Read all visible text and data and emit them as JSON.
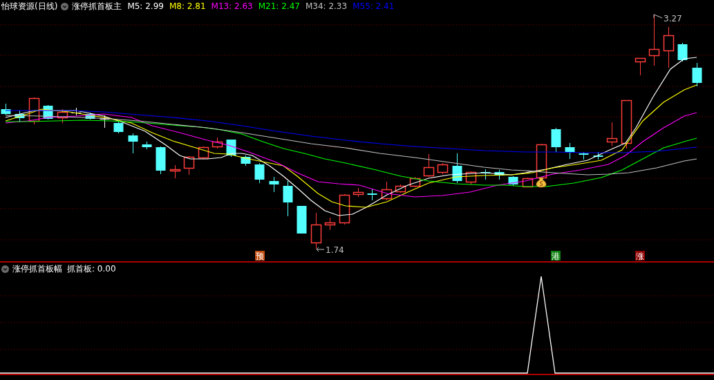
{
  "main_pane": {
    "title": "怡球资源(日线)",
    "indicator_name": "涨停抓首板主",
    "ma_readings": [
      {
        "label": "M5: 2.99",
        "color": "#ffffff"
      },
      {
        "label": "M8: 2.81",
        "color": "#ffff00"
      },
      {
        "label": "M13: 2.63",
        "color": "#ff00ff"
      },
      {
        "label": "M21: 2.47",
        "color": "#00ff00"
      },
      {
        "label": "M34: 2.33",
        "color": "#c0c0c0"
      },
      {
        "label": "M55: 2.41",
        "color": "#0000ff"
      }
    ],
    "high_label": "3.27",
    "low_label": "1.74",
    "signals": [
      {
        "text": "预",
        "color": "#c04a10"
      },
      {
        "text": "港",
        "color": "#108010"
      },
      {
        "text": "涨",
        "color": "#900000"
      }
    ]
  },
  "sub_pane": {
    "indicator_name": "涨停抓首板幅",
    "reading": "抓首板: 0.00"
  }
}
